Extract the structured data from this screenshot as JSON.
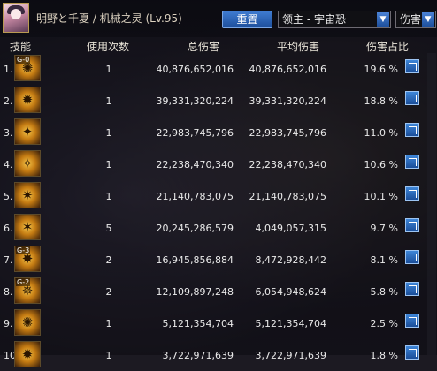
{
  "header": {
    "title": "明野と千夏 / 机械之灵 (Lv.95)",
    "reset_label": "重置",
    "target_select": "领主 - 宇宙恐",
    "metric_select": "伤害"
  },
  "columns": [
    "技能",
    "使用次数",
    "总伤害",
    "平均伤害",
    "伤害占比"
  ],
  "rows": [
    {
      "rank": "1.",
      "icon_tag": "G-0",
      "icon": "skill-icon",
      "uses": "1",
      "total": "40,876,652,016",
      "avg": "40,876,652,016",
      "pct": "19.6 %"
    },
    {
      "rank": "2.",
      "icon_tag": "",
      "icon": "skill-icon",
      "uses": "1",
      "total": "39,331,320,224",
      "avg": "39,331,320,224",
      "pct": "18.8 %"
    },
    {
      "rank": "3.",
      "icon_tag": "",
      "icon": "skill-icon",
      "uses": "1",
      "total": "22,983,745,796",
      "avg": "22,983,745,796",
      "pct": "11.0 %"
    },
    {
      "rank": "4.",
      "icon_tag": "",
      "icon": "skill-icon",
      "uses": "1",
      "total": "22,238,470,340",
      "avg": "22,238,470,340",
      "pct": "10.6 %"
    },
    {
      "rank": "5.",
      "icon_tag": "",
      "icon": "skill-icon",
      "uses": "1",
      "total": "21,140,783,075",
      "avg": "21,140,783,075",
      "pct": "10.1 %"
    },
    {
      "rank": "6.",
      "icon_tag": "",
      "icon": "skill-icon",
      "uses": "5",
      "total": "20,245,286,579",
      "avg": "4,049,057,315",
      "pct": "9.7 %"
    },
    {
      "rank": "7.",
      "icon_tag": "G-3",
      "icon": "skill-icon",
      "uses": "2",
      "total": "16,945,856,884",
      "avg": "8,472,928,442",
      "pct": "8.1 %"
    },
    {
      "rank": "8.",
      "icon_tag": "G-2",
      "icon": "skill-icon",
      "uses": "2",
      "total": "12,109,897,248",
      "avg": "6,054,948,624",
      "pct": "5.8 %"
    },
    {
      "rank": "9.",
      "icon_tag": "",
      "icon": "skill-icon",
      "uses": "1",
      "total": "5,121,354,704",
      "avg": "5,121,354,704",
      "pct": "2.5 %"
    },
    {
      "rank": "10.",
      "icon_tag": "",
      "icon": "skill-icon",
      "uses": "1",
      "total": "3,722,971,639",
      "avg": "3,722,971,639",
      "pct": "1.8 %"
    }
  ]
}
